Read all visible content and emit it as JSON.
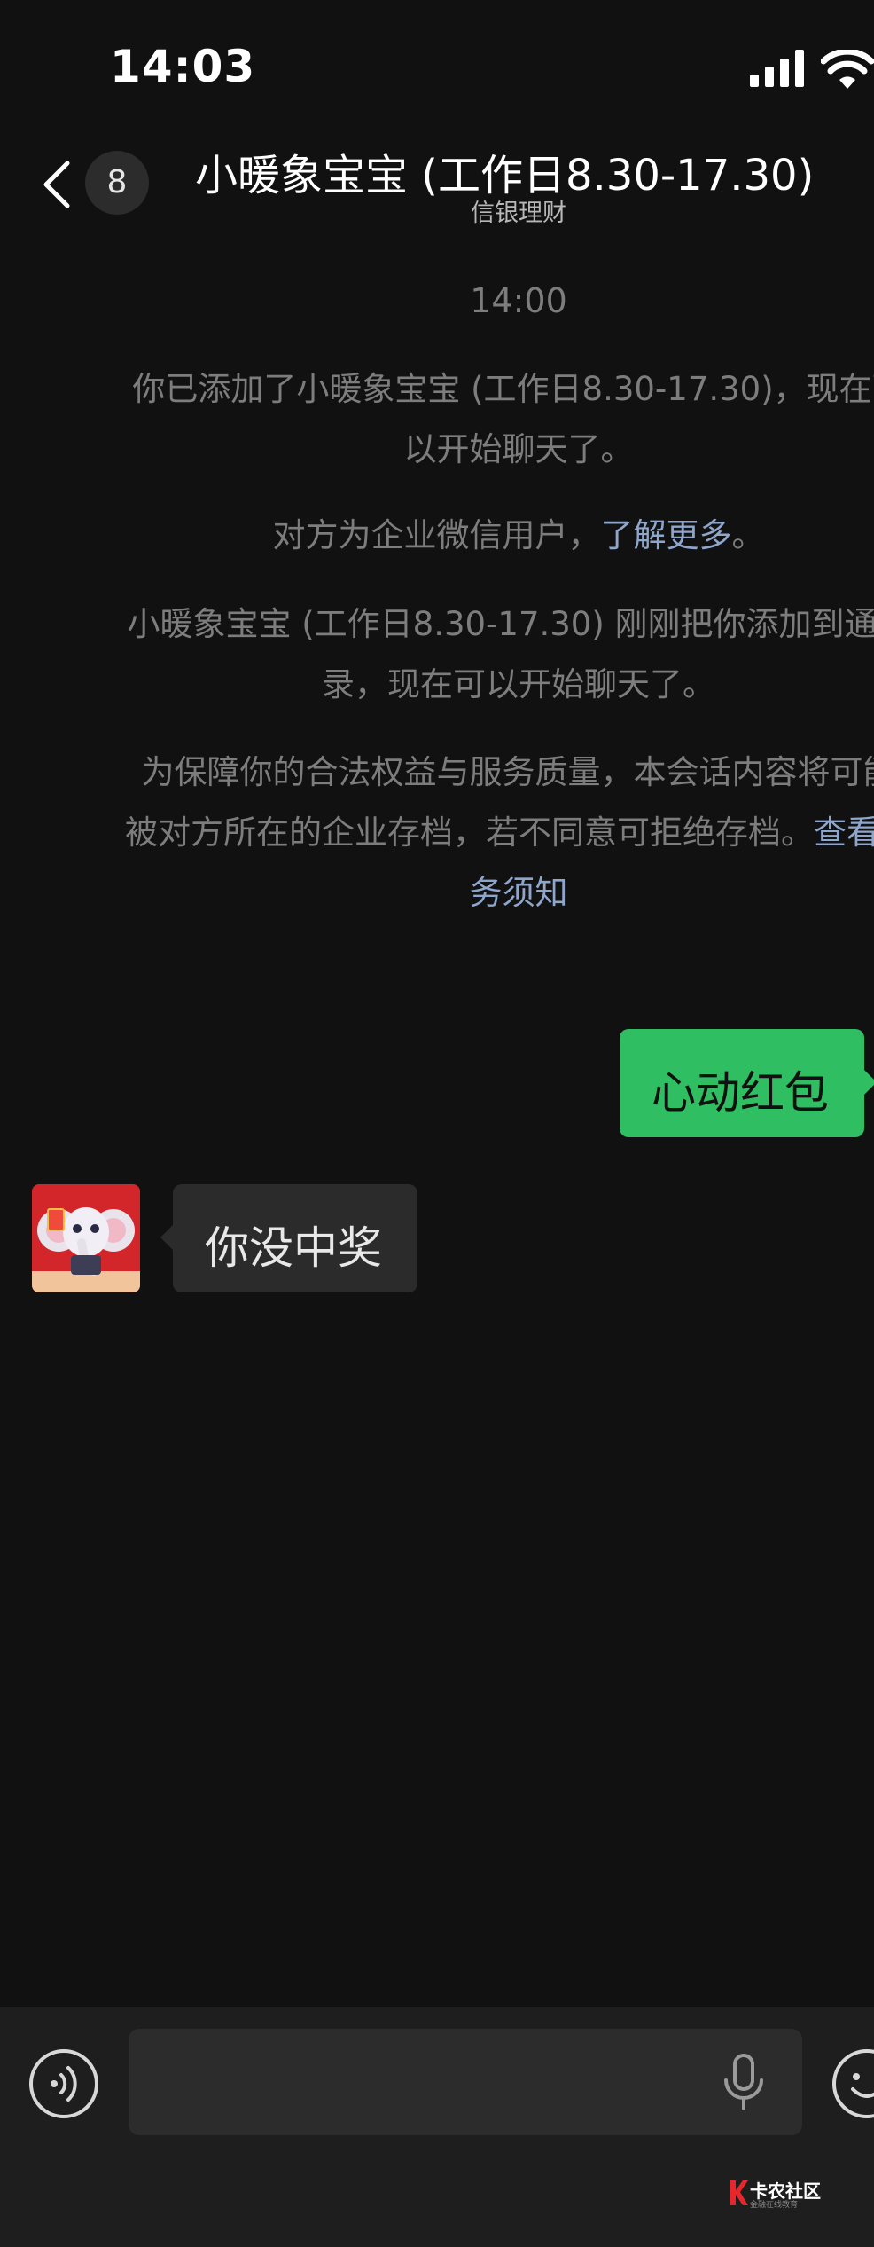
{
  "status_bar": {
    "time": "14:03"
  },
  "header": {
    "unread_count": "8",
    "title": "小暖象宝宝 (工作日8.30-17.30)",
    "subtitle": "信银理财"
  },
  "system_messages": {
    "timestamp": "14:00",
    "added_line1": "你已添加了小暖象宝宝 (工作日8.30-17.30)，现在可",
    "added_line2": "以开始聊天了。",
    "enterprise_prefix": "对方为企业微信用户，",
    "enterprise_link": "了解更多",
    "enterprise_suffix": "。",
    "contact_line1": "小暖象宝宝 (工作日8.30-17.30) 刚刚把你添加到通讯",
    "contact_line2": "录，现在可以开始聊天了。",
    "archive_line1": "为保障你的合法权益与服务质量，本会话内容将可能",
    "archive_line2_text": "被对方所在的企业存档，若不同意可拒绝存档。",
    "archive_line2_link": "查看服",
    "archive_line3_link": "务须知"
  },
  "messages": [
    {
      "direction": "outgoing",
      "text": "心动红包"
    },
    {
      "direction": "incoming",
      "text": "你没中奖"
    }
  ],
  "input_bar": {
    "value": "",
    "placeholder": ""
  },
  "watermark": {
    "text": "卡农社区",
    "subtext": "金融在线教育"
  },
  "colors": {
    "background": "#111111",
    "outgoing_bubble": "#2fbe61",
    "incoming_bubble": "#2b2b2b",
    "link": "#8fa6cc",
    "system_text": "#7d7d7d"
  },
  "icons": {
    "signal": "signal-bars-icon",
    "wifi": "wifi-icon",
    "back": "chevron-left-icon",
    "voice": "voice-mode-icon",
    "mic": "microphone-icon",
    "emoji": "emoji-icon",
    "avatar": "elephant-avatar"
  }
}
